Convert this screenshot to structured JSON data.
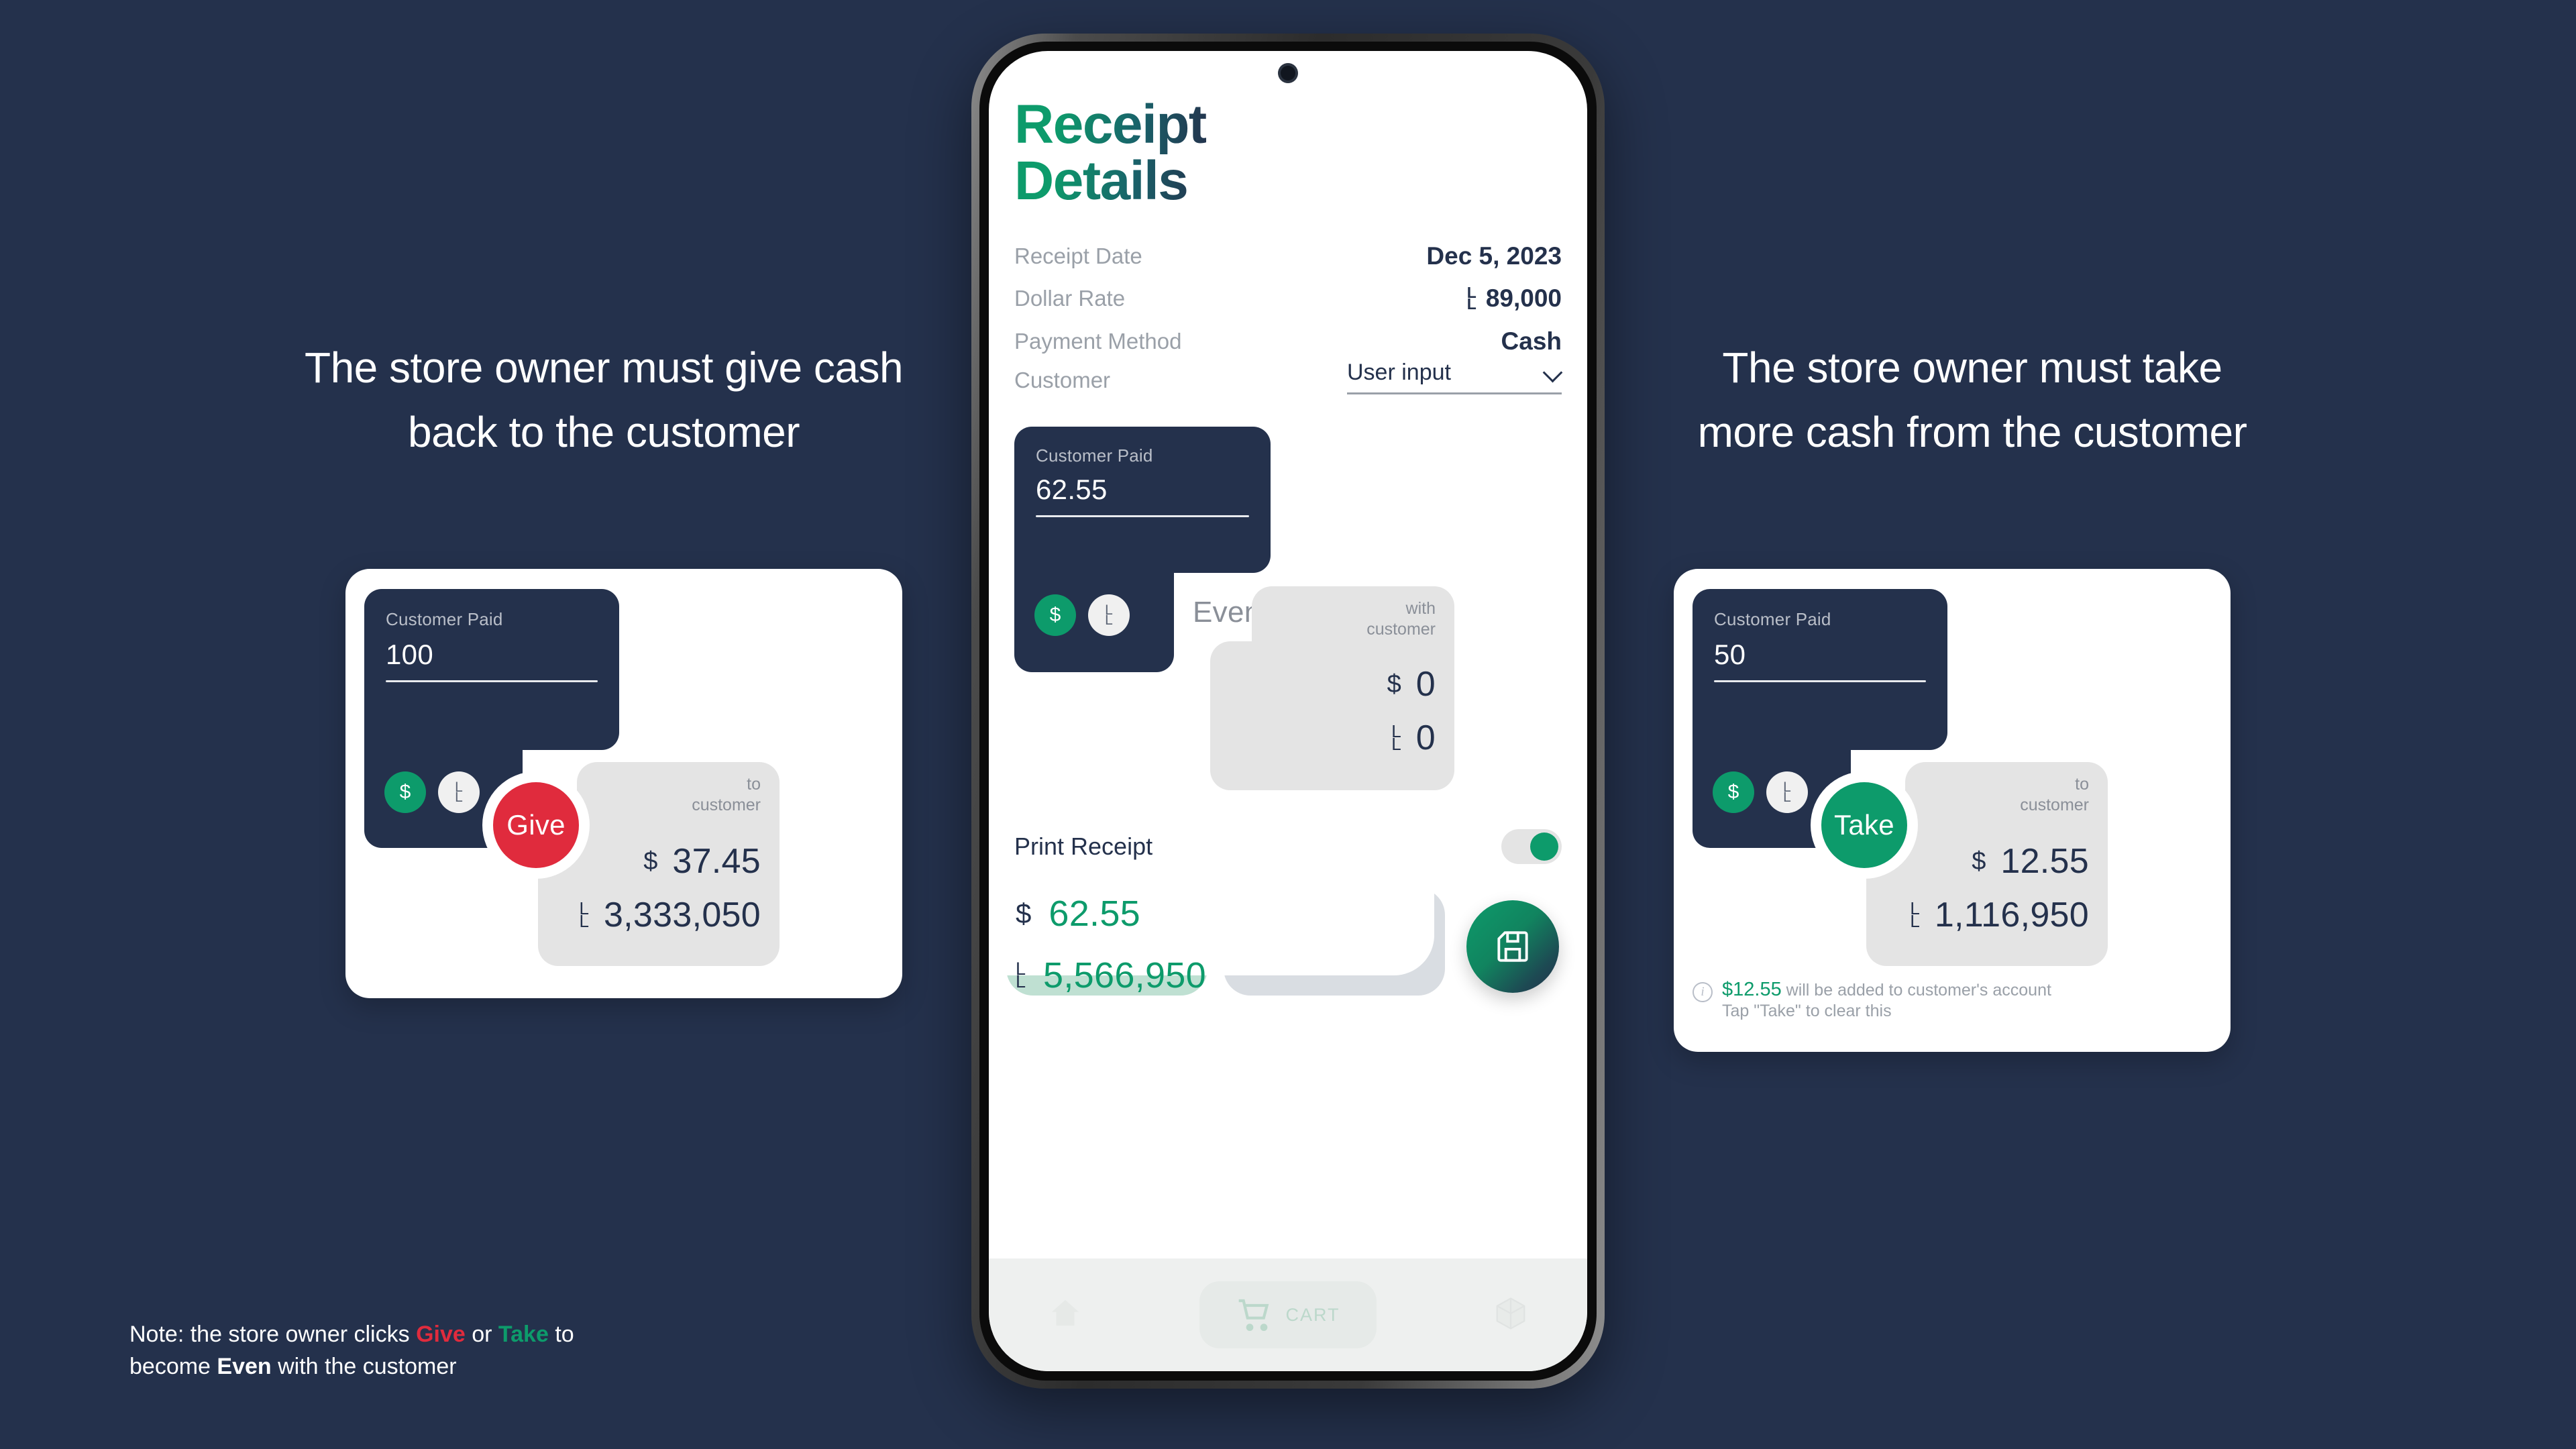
{
  "colors": {
    "background": "#24314c",
    "accent_green": "#0d9b6b",
    "accent_red": "#e02b3d",
    "navy": "#24314c",
    "grey_panel": "#e4e4e4"
  },
  "left_panel": {
    "heading": "The store owner must give cash back to the customer",
    "card": {
      "paid_label": "Customer Paid",
      "paid_value": "100",
      "currency_chips": [
        {
          "name": "dollar",
          "glyph": "$"
        },
        {
          "name": "lira",
          "glyph": "L.L"
        }
      ],
      "action_label": "Give",
      "action_color": "#e02b3d",
      "amount_caption_line1": "to",
      "amount_caption_line2": "customer",
      "amounts": [
        {
          "symbol": "$",
          "value": "37.45"
        },
        {
          "symbol": "L.L",
          "value": "3,333,050"
        }
      ]
    }
  },
  "right_panel": {
    "heading": "The store owner must take more cash from the customer",
    "card": {
      "paid_label": "Customer Paid",
      "paid_value": "50",
      "currency_chips": [
        {
          "name": "dollar",
          "glyph": "$"
        },
        {
          "name": "lira",
          "glyph": "L.L"
        }
      ],
      "action_label": "Take",
      "action_color": "#0d9b6b",
      "amount_caption_line1": "to",
      "amount_caption_line2": "customer",
      "amounts": [
        {
          "symbol": "$",
          "value": "12.55"
        },
        {
          "symbol": "L.L",
          "value": "1,116,950"
        }
      ],
      "info_amount": "$12.55",
      "info_line1_rest": " will be added to customer's account",
      "info_line2": "Tap \"Take\" to clear this"
    }
  },
  "bottom_note": {
    "prefix": "Note: the store owner clicks ",
    "give": "Give",
    "middle": " or ",
    "take": "Take",
    "suffix_line1": " to",
    "line2_prefix": "become ",
    "even": "Even",
    "line2_suffix": " with the customer"
  },
  "phone": {
    "app_title_line1": "Receipt",
    "app_title_line2": "Details",
    "details": [
      {
        "label": "Receipt Date",
        "value": "Dec 5, 2023",
        "symbol": ""
      },
      {
        "label": "Dollar Rate",
        "value": "89,000",
        "symbol": "L.L"
      },
      {
        "label": "Payment Method",
        "value": "Cash",
        "symbol": ""
      }
    ],
    "customer": {
      "label": "Customer",
      "selected": "User input"
    },
    "card": {
      "paid_label": "Customer Paid",
      "paid_value": "62.55",
      "currency_chips": [
        {
          "name": "dollar",
          "glyph": "$"
        },
        {
          "name": "lira",
          "glyph": "L.L"
        }
      ],
      "state_label": "Even",
      "amount_caption_line1": "with",
      "amount_caption_line2": "customer",
      "amounts": [
        {
          "symbol": "$",
          "value": "0"
        },
        {
          "symbol": "L.L",
          "value": "0"
        }
      ]
    },
    "print_receipt": {
      "label": "Print Receipt",
      "enabled": "on"
    },
    "totals": [
      {
        "symbol": "$",
        "value": "62.55"
      },
      {
        "symbol": "L.L",
        "value": "5,566,950"
      }
    ],
    "save_button": "save-icon",
    "bottom_nav": [
      {
        "name": "home",
        "label": ""
      },
      {
        "name": "cart",
        "label": "CART"
      },
      {
        "name": "products",
        "label": ""
      }
    ]
  }
}
